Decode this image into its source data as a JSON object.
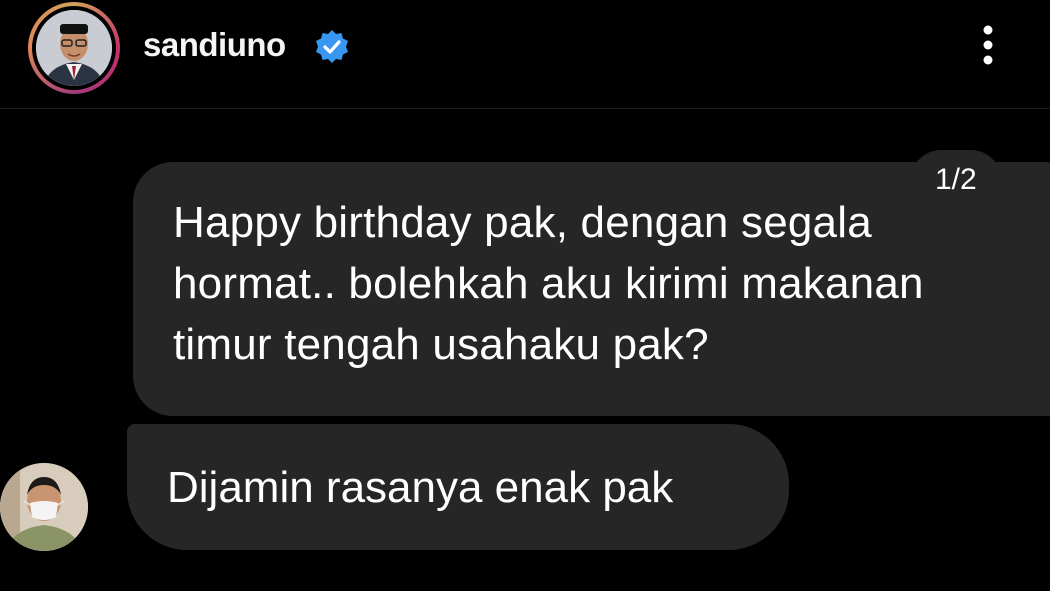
{
  "header": {
    "username": "sandiuno",
    "verified": true,
    "avatar_icon": "profile-photo-icon",
    "more_icon": "more-vertical-icon"
  },
  "messages": [
    {
      "lines": [
        "Happy birthday pak, dengan segala",
        "hormat.. bolehkah aku kirimi makanan",
        "timur tengah usahaku pak?"
      ],
      "page_indicator": "1/2"
    },
    {
      "lines": [
        "Dijamin rasanya enak pak"
      ],
      "sender_avatar_icon": "sender-profile-photo-icon"
    }
  ],
  "colors": {
    "background": "#000000",
    "bubble": "#262626",
    "verified_badge": "#3897f0",
    "text": "#ffffff"
  }
}
